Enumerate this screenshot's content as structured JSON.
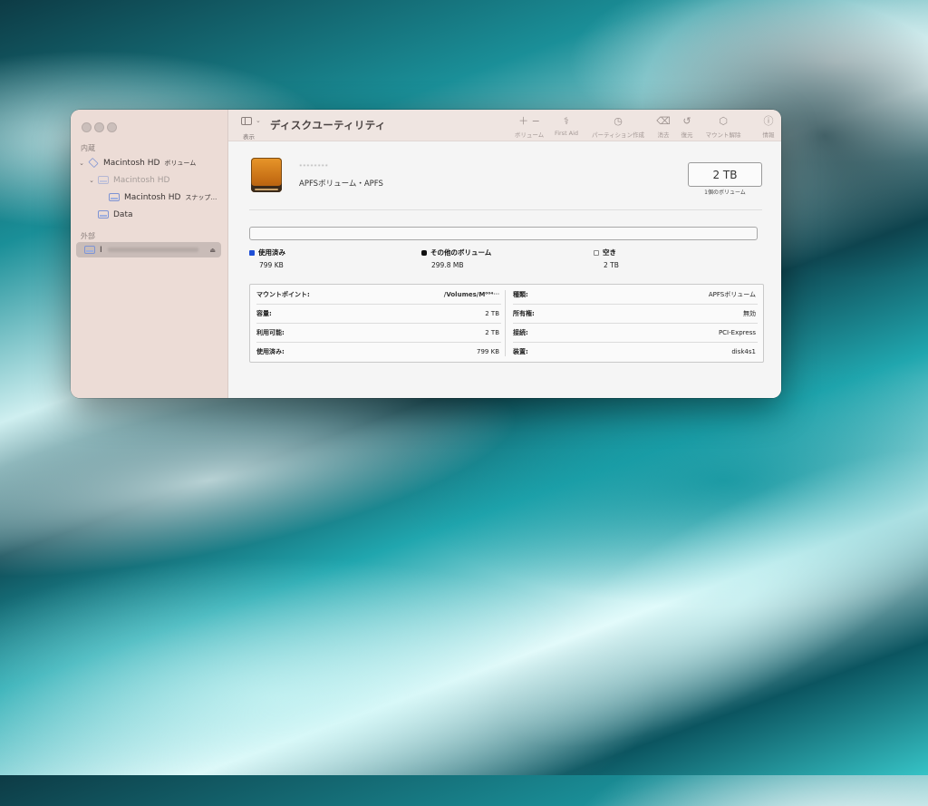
{
  "toolbar": {
    "title": "ディスクユーティリティ",
    "sidebar_label": "表示",
    "buttons": [
      {
        "glyph": "＋ −",
        "label": "ボリューム"
      },
      {
        "glyph": "⚕",
        "label": "First Aid"
      },
      {
        "glyph": "◷",
        "label": "パーティション作成"
      },
      {
        "glyph": "⌫",
        "label": "消去"
      },
      {
        "glyph": "↺",
        "label": "復元"
      },
      {
        "glyph": "⬡",
        "label": "マウント解除"
      },
      {
        "glyph": "ⓘ",
        "label": "情報"
      }
    ]
  },
  "sidebar": {
    "internal_label": "内蔵",
    "external_label": "外部",
    "items": [
      {
        "label": "Macintosh HD",
        "sub": "ボリューム"
      },
      {
        "label": "Macintosh HD",
        "sub": ""
      },
      {
        "label": "Macintosh HD",
        "sub": "スナップ…"
      },
      {
        "label": "Data",
        "sub": ""
      },
      {
        "label": "I",
        "sub": ""
      }
    ]
  },
  "volume": {
    "name": "ᐧᐧᐧᐧᐧᐧᐧᐧ",
    "subtitle": "APFSボリューム・APFS",
    "capacity_display": "2 TB",
    "capacity_sub": "1個のボリューム"
  },
  "usage": {
    "legend": [
      {
        "label": "使用済み",
        "value": "799 KB",
        "color": "#1f4fd6"
      },
      {
        "label": "その他のボリューム",
        "value": "299.8 MB",
        "color": "#111111"
      },
      {
        "label": "空き",
        "value": "2 TB",
        "color": "#ffffff"
      }
    ]
  },
  "info": {
    "left": [
      {
        "key": "マウントポイント:",
        "value": "/Volumes/M⁰⁰⁴ᐧᐧᐧ"
      },
      {
        "key": "容量:",
        "value": "2 TB"
      },
      {
        "key": "利用可能:",
        "value": "2 TB"
      },
      {
        "key": "使用済み:",
        "value": "799 KB"
      }
    ],
    "right": [
      {
        "key": "種類:",
        "value": "APFSボリューム"
      },
      {
        "key": "所有権:",
        "value": "無効"
      },
      {
        "key": "接続:",
        "value": "PCI-Express"
      },
      {
        "key": "装置:",
        "value": "disk4s1"
      }
    ]
  }
}
